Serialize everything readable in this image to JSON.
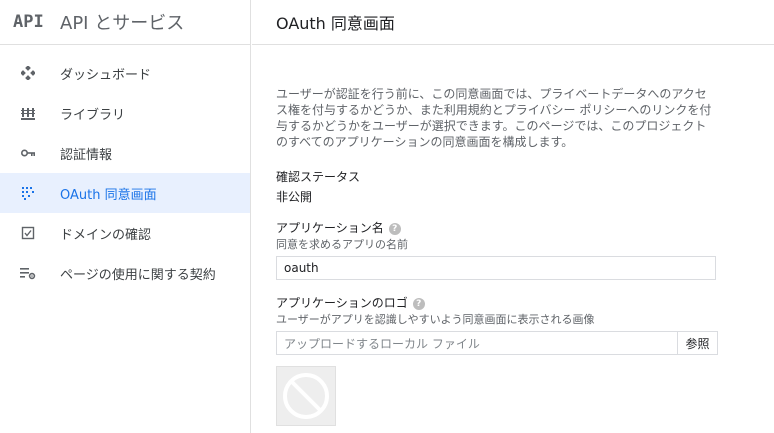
{
  "brand": {
    "logo": "API",
    "title": "API とサービス"
  },
  "sidebar": {
    "items": [
      {
        "label": "ダッシュボード",
        "icon": "dashboard-icon"
      },
      {
        "label": "ライブラリ",
        "icon": "library-icon"
      },
      {
        "label": "認証情報",
        "icon": "key-icon"
      },
      {
        "label": "OAuth 同意画面",
        "icon": "consent-screen-icon",
        "active": true
      },
      {
        "label": "ドメインの確認",
        "icon": "domain-verification-icon"
      },
      {
        "label": "ページの使用に関する契約",
        "icon": "page-usage-agreement-icon"
      }
    ]
  },
  "main": {
    "title": "OAuth 同意画面",
    "description": "ユーザーが認証を行う前に、この同意画面では、プライベートデータへのアクセス権を付与するかどうか、また利用規約とプライバシー ポリシーへのリンクを付与するかどうかをユーザーが選択できます。このページでは、このプロジェクトのすべてのアプリケーションの同意画面を構成します。",
    "status": {
      "label": "確認ステータス",
      "value": "非公開"
    },
    "app_name": {
      "label": "アプリケーション名",
      "help": "?",
      "sub": "同意を求めるアプリの名前",
      "value": "oauth"
    },
    "app_logo": {
      "label": "アプリケーションのロゴ",
      "help": "?",
      "sub": "ユーザーがアプリを認識しやすいよう同意画面に表示される画像",
      "placeholder": "アップロードするローカル ファイル",
      "browse_label": "参照"
    }
  },
  "colors": {
    "accent": "#1a73e8",
    "active_bg": "#e8f0fe",
    "border": "#e0e0e0"
  }
}
